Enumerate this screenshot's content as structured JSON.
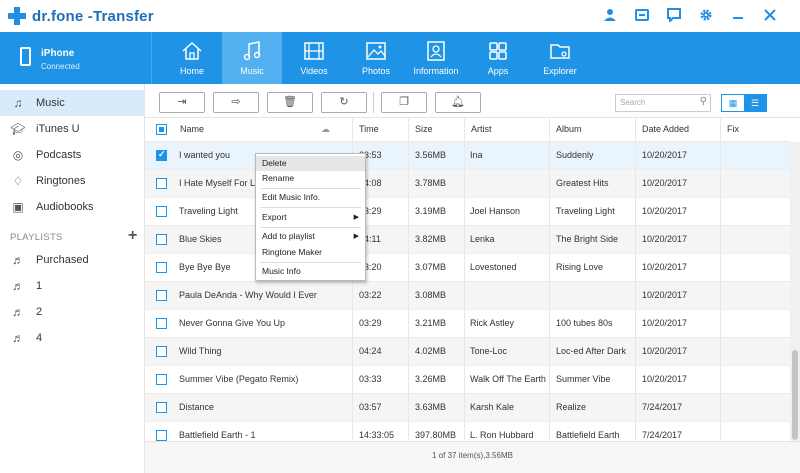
{
  "app": {
    "title": "dr.fone -Transfer"
  },
  "window_icons": [
    "user-icon",
    "inbox-icon",
    "chat-icon",
    "settings-icon",
    "minimize-icon",
    "close-icon"
  ],
  "device": {
    "name": "iPhone",
    "status": "Connected"
  },
  "tabs": [
    {
      "label": "Home",
      "icon": "home-icon"
    },
    {
      "label": "Music",
      "icon": "music-icon",
      "active": true
    },
    {
      "label": "Videos",
      "icon": "film-icon"
    },
    {
      "label": "Photos",
      "icon": "photo-icon"
    },
    {
      "label": "Information",
      "icon": "contact-icon"
    },
    {
      "label": "Apps",
      "icon": "apps-icon"
    },
    {
      "label": "Explorer",
      "icon": "folder-icon"
    }
  ],
  "sidebar": {
    "items": [
      {
        "label": "Music",
        "icon": "music-note-icon",
        "active": true
      },
      {
        "label": "iTunes U",
        "icon": "graduation-icon"
      },
      {
        "label": "Podcasts",
        "icon": "podcast-icon"
      },
      {
        "label": "Ringtones",
        "icon": "bell-icon"
      },
      {
        "label": "Audiobooks",
        "icon": "book-icon"
      }
    ],
    "playlists_header": "PLAYLISTS",
    "add_label": "+",
    "playlists": [
      {
        "label": "Purchased"
      },
      {
        "label": "1"
      },
      {
        "label": "2"
      },
      {
        "label": "4"
      }
    ]
  },
  "toolbar": {
    "buttons": [
      "import-icon",
      "export-icon",
      "delete-icon",
      "refresh-icon",
      "dedupe-icon",
      "ringtone-icon"
    ],
    "search_placeholder": "Search"
  },
  "table": {
    "columns": [
      "Name",
      "Time",
      "Size",
      "Artist",
      "Album",
      "Date Added",
      "Fix"
    ],
    "rows": [
      {
        "checked": true,
        "name": "I wanted you",
        "time": "03:53",
        "size": "3.56MB",
        "artist": "Ina",
        "album": "Suddenly",
        "date": "10/20/2017"
      },
      {
        "checked": false,
        "name": "I Hate Myself For Lo",
        "time": "04:08",
        "size": "3.78MB",
        "artist": "",
        "album": "Greatest Hits",
        "date": "10/20/2017"
      },
      {
        "checked": false,
        "name": "Traveling Light",
        "time": "03:29",
        "size": "3.19MB",
        "artist": "Joel Hanson",
        "album": "Traveling Light",
        "date": "10/20/2017"
      },
      {
        "checked": false,
        "name": "Blue Skies",
        "time": "04:11",
        "size": "3.82MB",
        "artist": "Lenka",
        "album": "The Bright Side",
        "date": "10/20/2017"
      },
      {
        "checked": false,
        "name": "Bye Bye Bye",
        "time": "03:20",
        "size": "3.07MB",
        "artist": "Lovestoned",
        "album": "Rising Love",
        "date": "10/20/2017"
      },
      {
        "checked": false,
        "name": "Paula DeAnda - Why Would I Ever",
        "time": "03:22",
        "size": "3.08MB",
        "artist": "",
        "album": "",
        "date": "10/20/2017"
      },
      {
        "checked": false,
        "name": "Never Gonna Give You Up",
        "time": "03:29",
        "size": "3.21MB",
        "artist": "Rick Astley",
        "album": "100 tubes 80s",
        "date": "10/20/2017"
      },
      {
        "checked": false,
        "name": "Wild Thing",
        "time": "04:24",
        "size": "4.02MB",
        "artist": "Tone-Loc",
        "album": "Loc-ed After Dark",
        "date": "10/20/2017"
      },
      {
        "checked": false,
        "name": "Summer Vibe (Pegato Remix)",
        "time": "03:33",
        "size": "3.26MB",
        "artist": "Walk Off The Earth",
        "album": "Summer Vibe",
        "date": "10/20/2017"
      },
      {
        "checked": false,
        "name": "Distance",
        "time": "03:57",
        "size": "3.63MB",
        "artist": "Karsh Kale",
        "album": "Realize",
        "date": "7/24/2017"
      },
      {
        "checked": false,
        "name": "Battlefield Earth - 1",
        "time": "14:33:05",
        "size": "397.80MB",
        "artist": "L. Ron Hubbard",
        "album": "Battlefield Earth",
        "date": "7/24/2017"
      }
    ]
  },
  "status": "1 of 37 item(s),3.56MB",
  "context_menu": {
    "items": [
      {
        "label": "Delete",
        "hover": true
      },
      {
        "label": "Rename"
      },
      {
        "label": "Edit Music Info."
      },
      {
        "label": "Export",
        "submenu": true
      },
      {
        "label": "Add to playlist",
        "submenu": true
      },
      {
        "label": "Ringtone Maker"
      },
      {
        "label": "Music Info"
      }
    ]
  },
  "colors": {
    "accent": "#1f93e6",
    "active_tab": "#52b0f0",
    "sidebar_active": "#d7ebfb"
  }
}
